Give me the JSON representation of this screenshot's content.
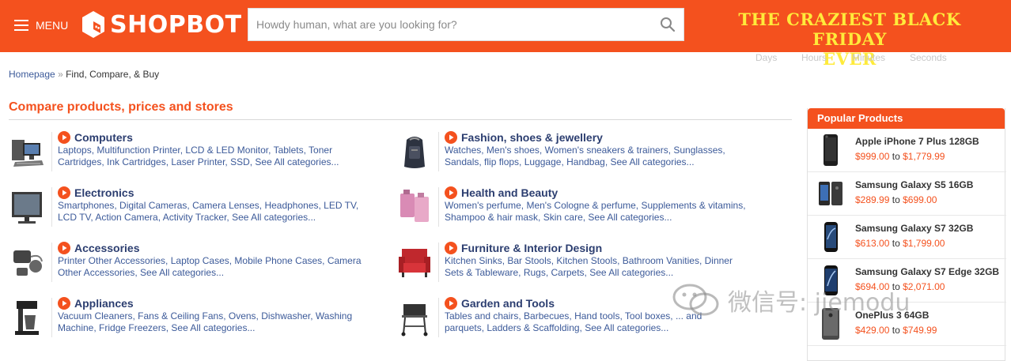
{
  "header": {
    "menu_label": "MENU",
    "logo_text": "SHOPBOT",
    "search_placeholder": "Howdy human, what are you looking for?",
    "promo_line1": "THE CRAZIEST BLACK FRIDAY",
    "promo_line2": "EVER",
    "countdown_labels": [
      "Days",
      "Hours",
      "Minutes",
      "Seconds"
    ],
    "brand_color": "#f4511e",
    "promo_color": "#ffeb3b"
  },
  "breadcrumb": {
    "home": "Homepage",
    "separator": "»",
    "current": "Find, Compare, & Buy"
  },
  "section_title": "Compare products, prices and stores",
  "categories": [
    {
      "name": "Computers",
      "icon": "desktop-computer-icon",
      "line1": "Laptops, Multifunction Printer, LCD & LED Monitor, Tablets, Toner",
      "line2": "Cartridges, Ink Cartridges, Laser Printer, SSD, See All categories..."
    },
    {
      "name": "Fashion, shoes & jewellery",
      "icon": "backpack-icon",
      "line1": "Watches, Men's shoes, Women's sneakers & trainers, Sunglasses,",
      "line2": "Sandals, flip flops, Luggage, Handbag, See All categories..."
    },
    {
      "name": "Electronics",
      "icon": "tv-icon",
      "line1": "Smartphones, Digital Cameras, Camera Lenses, Headphones, LED TV,",
      "line2": "LCD TV, Action Camera, Activity Tracker, See All categories..."
    },
    {
      "name": "Health and Beauty",
      "icon": "perfume-icon",
      "line1": "Women's perfume, Men's Cologne & perfume, Supplements & vitamins,",
      "line2": "Shampoo & hair mask, Skin care, See All categories..."
    },
    {
      "name": "Accessories",
      "icon": "accessories-icon",
      "line1": "Printer Other Accessories, Laptop Cases, Mobile Phone Cases, Camera",
      "line2": "Other Accessories, See All categories..."
    },
    {
      "name": "Furniture & Interior Design",
      "icon": "armchair-icon",
      "line1": "Kitchen Sinks, Bar Stools, Kitchen Stools, Bathroom Vanities, Dinner",
      "line2": "Sets & Tableware, Rugs, Carpets, See All categories..."
    },
    {
      "name": "Appliances",
      "icon": "coffee-maker-icon",
      "line1": "Vacuum Cleaners, Fans & Ceiling Fans, Ovens, Dishwasher, Washing",
      "line2": "Machine, Fridge Freezers, See All categories..."
    },
    {
      "name": "Garden and Tools",
      "icon": "barbecue-grill-icon",
      "line1": "Tables and chairs, Barbecues, Hand tools, Tool boxes, ... and",
      "line2": "parquets, Ladders & Scaffolding, See All categories..."
    }
  ],
  "popular": {
    "title": "Popular Products",
    "to_label": "to",
    "items": [
      {
        "name": "Apple iPhone 7 Plus 128GB",
        "low": "$999.00",
        "high": "$1,779.99"
      },
      {
        "name": "Samsung Galaxy S5 16GB",
        "low": "$289.99",
        "high": "$699.00"
      },
      {
        "name": "Samsung Galaxy S7 32GB",
        "low": "$613.00",
        "high": "$1,799.00"
      },
      {
        "name": "Samsung Galaxy S7 Edge 32GB",
        "low": "$694.00",
        "high": "$2,071.00"
      },
      {
        "name": "OnePlus 3 64GB",
        "low": "$429.00",
        "high": "$749.99"
      }
    ]
  },
  "watermark": "微信号: jiemodu"
}
